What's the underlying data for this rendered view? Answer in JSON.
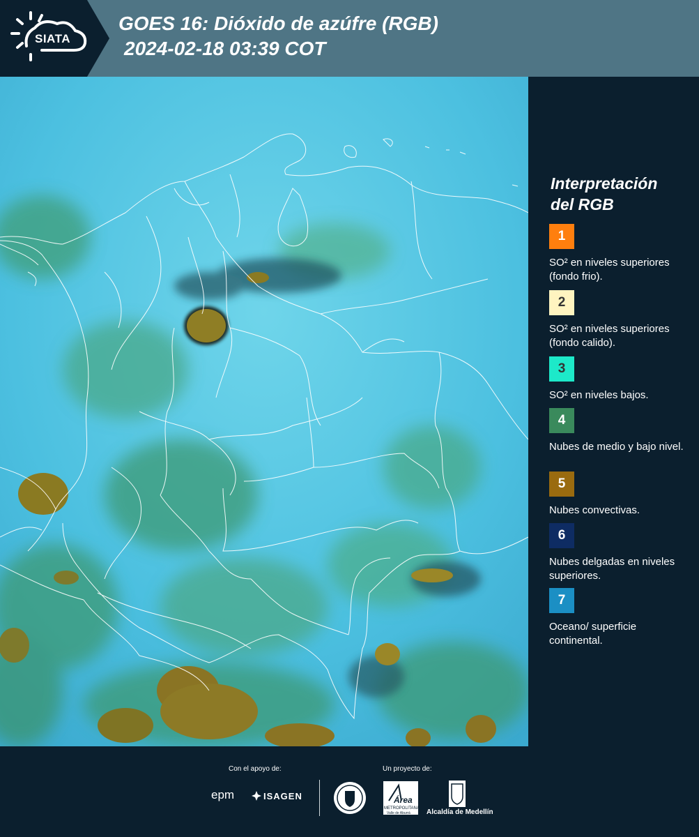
{
  "header": {
    "logo_text": "SIATA",
    "title_line1": "GOES 16: Dióxido de azúfre (RGB)",
    "title_line2": "2024-02-18 03:39 COT"
  },
  "legend": {
    "title_line1": "Interpretación",
    "title_line2": "del RGB",
    "items": [
      {
        "number": "1",
        "color": "#ff7f0e",
        "label": "SO² en niveles superiores (fondo frio)."
      },
      {
        "number": "2",
        "color": "#fff4c0",
        "label": "SO² en niveles superiores (fondo calido)."
      },
      {
        "number": "3",
        "color": "#1de9c9",
        "label": "SO² en niveles bajos."
      },
      {
        "number": "4",
        "color": "#3a8a5c",
        "label": "Nubes de medio y bajo nivel."
      },
      {
        "number": "5",
        "color": "#9a6b0f",
        "label": "Nubes convectivas."
      },
      {
        "number": "6",
        "color": "#0e2c63",
        "label": "Nubes delgadas en niveles superiores."
      },
      {
        "number": "7",
        "color": "#1b8fc4",
        "label": "Oceano/ superficie continental."
      }
    ]
  },
  "footer": {
    "support_label": "Con el apoyo de:",
    "project_label": "Un proyecto de:",
    "epm": "epm",
    "isagen": "ISAGEN",
    "area_name": "Área",
    "area_sub1": "METROPOLITANA",
    "area_sub2": "Valle de Aburrá",
    "alcaldia": "Alcaldía de Medellín"
  },
  "map": {
    "background_color": "#4dc4e3",
    "land_cloud_color": "#3f9e78",
    "convective_color": "#8a7a22"
  }
}
